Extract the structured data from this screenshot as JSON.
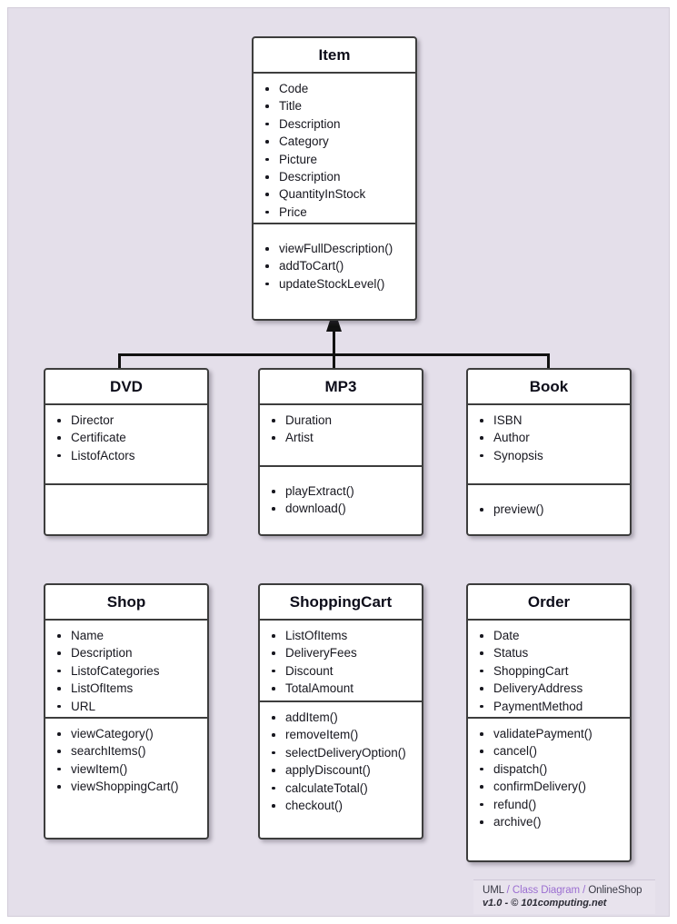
{
  "diagram": {
    "title": "OnlineShop UML Class Diagram",
    "background_color": "#e4dfea",
    "box_border_color": "#3d3d3d",
    "box_fill_color": "#ffffff",
    "accent_color": "#9b6ed1"
  },
  "classes": {
    "item": {
      "name": "Item",
      "attributes": [
        "Code",
        "Title",
        "Description",
        "Category",
        "Picture",
        "Description",
        "QuantityInStock",
        "Price"
      ],
      "methods": [
        "viewFullDescription()",
        "addToCart()",
        "updateStockLevel()"
      ]
    },
    "dvd": {
      "name": "DVD",
      "attributes": [
        "Director",
        "Certificate",
        "ListofActors"
      ],
      "methods": []
    },
    "mp3": {
      "name": "MP3",
      "attributes": [
        "Duration",
        "Artist"
      ],
      "methods": [
        "playExtract()",
        "download()"
      ]
    },
    "book": {
      "name": "Book",
      "attributes": [
        "ISBN",
        "Author",
        "Synopsis"
      ],
      "methods": [
        "preview()"
      ]
    },
    "shop": {
      "name": "Shop",
      "attributes": [
        "Name",
        "Description",
        "ListofCategories",
        "ListOfItems",
        "URL"
      ],
      "methods": [
        "viewCategory()",
        "searchItems()",
        "viewItem()",
        "viewShoppingCart()"
      ]
    },
    "shoppingcart": {
      "name": "ShoppingCart",
      "attributes": [
        "ListOfItems",
        "DeliveryFees",
        "Discount",
        "TotalAmount"
      ],
      "methods": [
        "addItem()",
        "removeItem()",
        "selectDeliveryOption()",
        "applyDiscount()",
        "calculateTotal()",
        "checkout()"
      ]
    },
    "order": {
      "name": "Order",
      "attributes": [
        "Date",
        "Status",
        "ShoppingCart",
        "DeliveryAddress",
        "PaymentMethod"
      ],
      "methods": [
        "validatePayment()",
        "cancel()",
        "dispatch()",
        "confirmDelivery()",
        "refund()",
        "archive()"
      ]
    }
  },
  "relationships": {
    "generalization": {
      "type": "inheritance",
      "parent": "Item",
      "children": [
        "DVD",
        "MP3",
        "Book"
      ]
    }
  },
  "footer": {
    "notation": "UML",
    "separator_1": "/",
    "kind": "Class Diagram",
    "separator_2": "/",
    "subject": "OnlineShop",
    "version_line": "v1.0  - © 101computing.net"
  }
}
